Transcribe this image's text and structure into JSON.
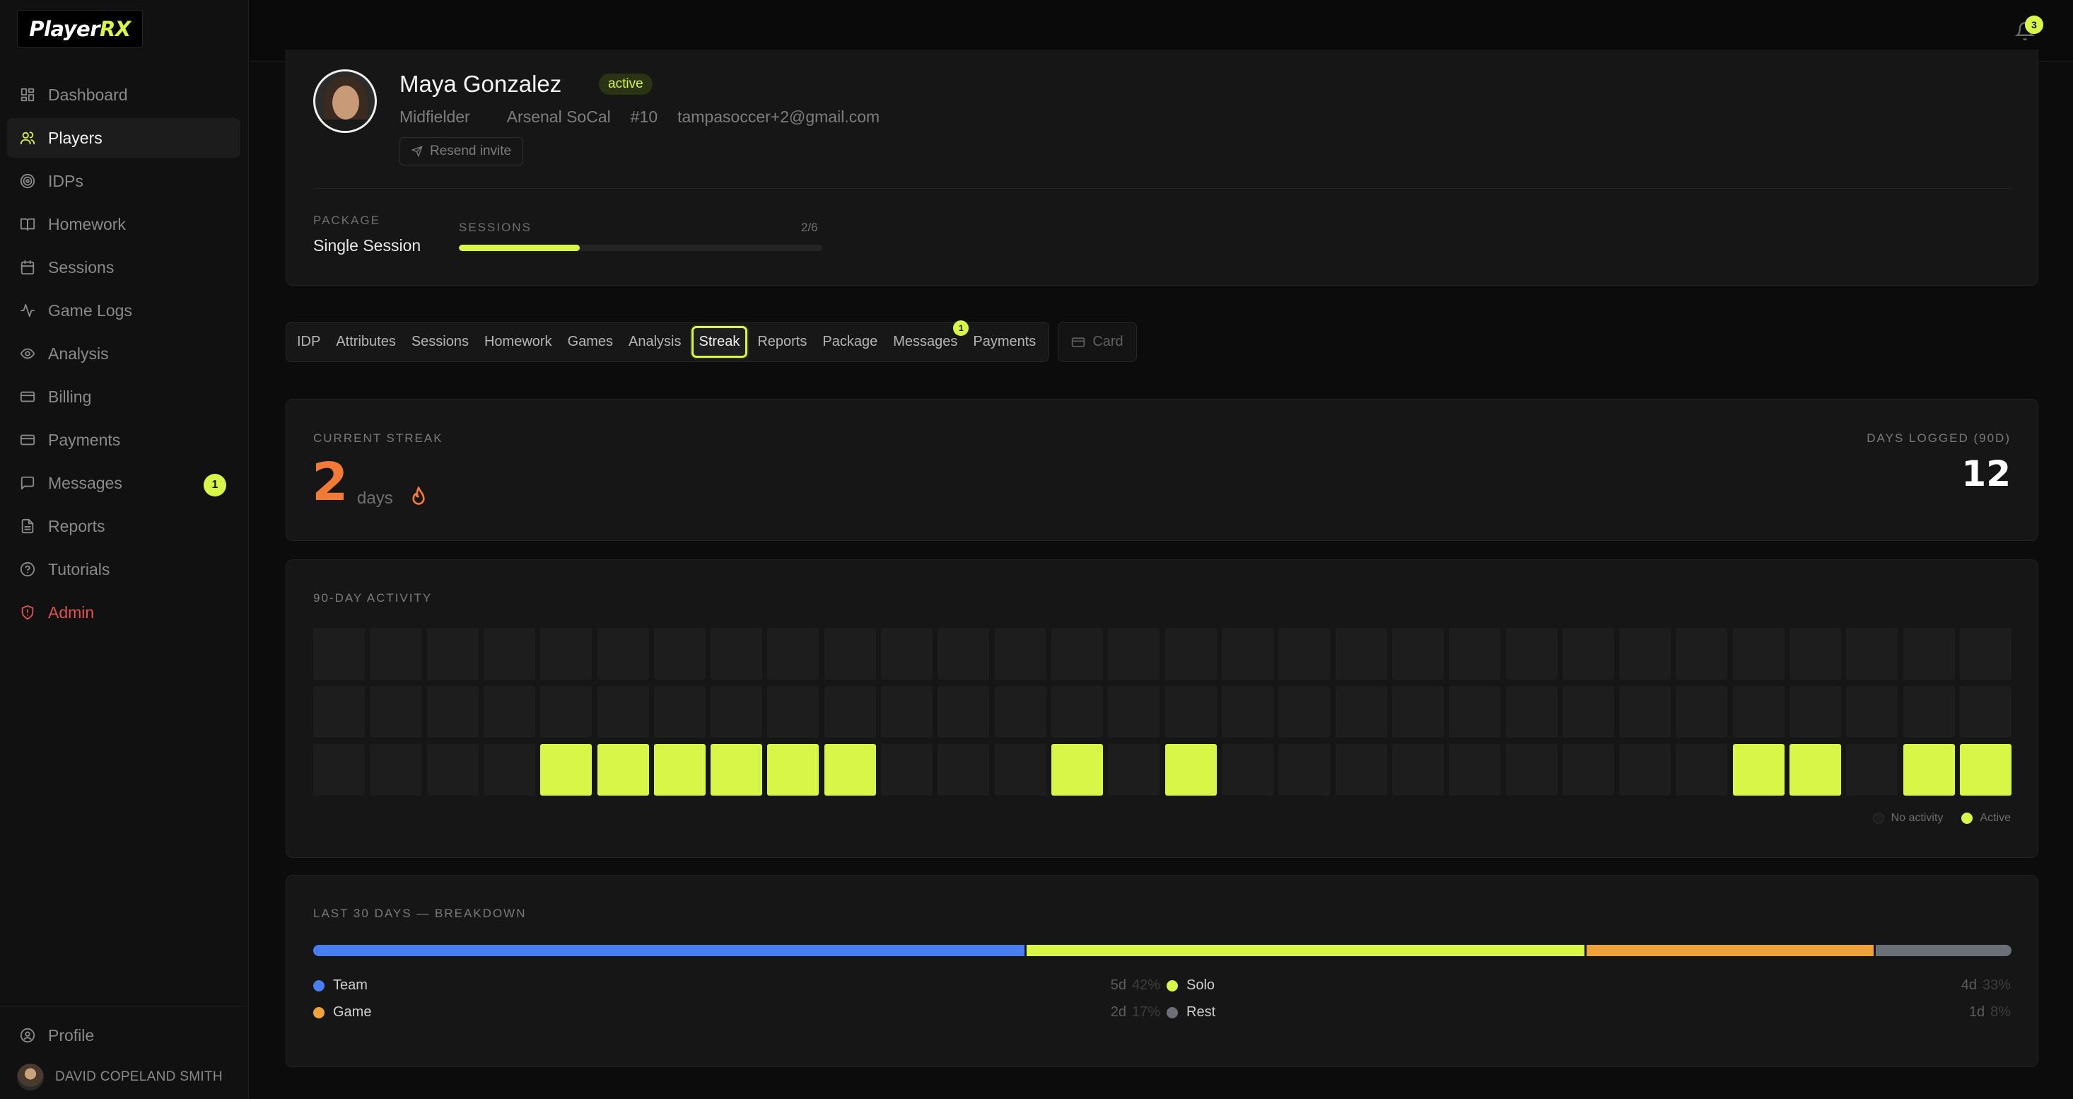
{
  "app": {
    "logo_main": "Player",
    "logo_accent": "RX"
  },
  "sidebar": {
    "items": [
      {
        "label": "Dashboard",
        "icon": "grid-icon"
      },
      {
        "label": "Players",
        "icon": "users-icon"
      },
      {
        "label": "IDPs",
        "icon": "target-icon"
      },
      {
        "label": "Homework",
        "icon": "book-icon"
      },
      {
        "label": "Sessions",
        "icon": "calendar-icon"
      },
      {
        "label": "Game Logs",
        "icon": "activity-icon"
      },
      {
        "label": "Analysis",
        "icon": "eye-icon"
      },
      {
        "label": "Billing",
        "icon": "credit-card-icon"
      },
      {
        "label": "Payments",
        "icon": "credit-card-icon"
      },
      {
        "label": "Messages",
        "icon": "message-icon",
        "badge": "1"
      },
      {
        "label": "Reports",
        "icon": "file-icon"
      },
      {
        "label": "Tutorials",
        "icon": "help-icon"
      },
      {
        "label": "Admin",
        "icon": "shield-icon"
      }
    ],
    "active": "Players",
    "profile_label": "Profile",
    "user_name": "DAVID COPELAND SMITH"
  },
  "topbar": {
    "notification_count": "3"
  },
  "player": {
    "name": "Maya Gonzalez",
    "status": "active",
    "position": "Midfielder",
    "club": "Arsenal SoCal",
    "number": "#10",
    "email": "tampasoccer+2@gmail.com",
    "resend_label": "Resend invite",
    "package_label": "PACKAGE",
    "package_value": "Single Session",
    "sessions_label": "SESSIONS",
    "sessions_count": "2/6",
    "sessions_progress": 0.333
  },
  "tabs": [
    {
      "label": "IDP"
    },
    {
      "label": "Attributes"
    },
    {
      "label": "Sessions"
    },
    {
      "label": "Homework"
    },
    {
      "label": "Games"
    },
    {
      "label": "Analysis"
    },
    {
      "label": "Streak",
      "active": true
    },
    {
      "label": "Reports"
    },
    {
      "label": "Package"
    },
    {
      "label": "Messages",
      "badge": "1"
    },
    {
      "label": "Payments"
    }
  ],
  "card_button_label": "Card",
  "streak": {
    "current_label": "CURRENT STREAK",
    "current_value": "2",
    "current_unit": "days",
    "logged_label": "DAYS LOGGED (90D)",
    "logged_value": "12"
  },
  "activity": {
    "label": "90-DAY ACTIVITY",
    "weeks": 30,
    "rows": 3,
    "active_cells": [
      [
        2,
        4
      ],
      [
        2,
        5
      ],
      [
        2,
        6
      ],
      [
        2,
        7
      ],
      [
        2,
        8
      ],
      [
        2,
        9
      ],
      [
        2,
        13
      ],
      [
        2,
        15
      ],
      [
        2,
        25
      ],
      [
        2,
        26
      ],
      [
        2,
        28
      ],
      [
        2,
        29
      ]
    ],
    "legend_none": "No activity",
    "legend_active": "Active"
  },
  "breakdown": {
    "label": "LAST 30 DAYS — BREAKDOWN",
    "items": [
      {
        "name": "Team",
        "days": "5d",
        "pct": "42%",
        "share": 0.42,
        "color": "#4a7df0"
      },
      {
        "name": "Solo",
        "days": "4d",
        "pct": "33%",
        "share": 0.33,
        "color": "#d8f648"
      },
      {
        "name": "Game",
        "days": "2d",
        "pct": "17%",
        "share": 0.17,
        "color": "#eda23a"
      },
      {
        "name": "Rest",
        "days": "1d",
        "pct": "8%",
        "share": 0.08,
        "color": "#6b6f78"
      }
    ]
  },
  "colors": {
    "accent": "#d8f648",
    "streak": "#f07a36",
    "admin": "#e0524f"
  }
}
